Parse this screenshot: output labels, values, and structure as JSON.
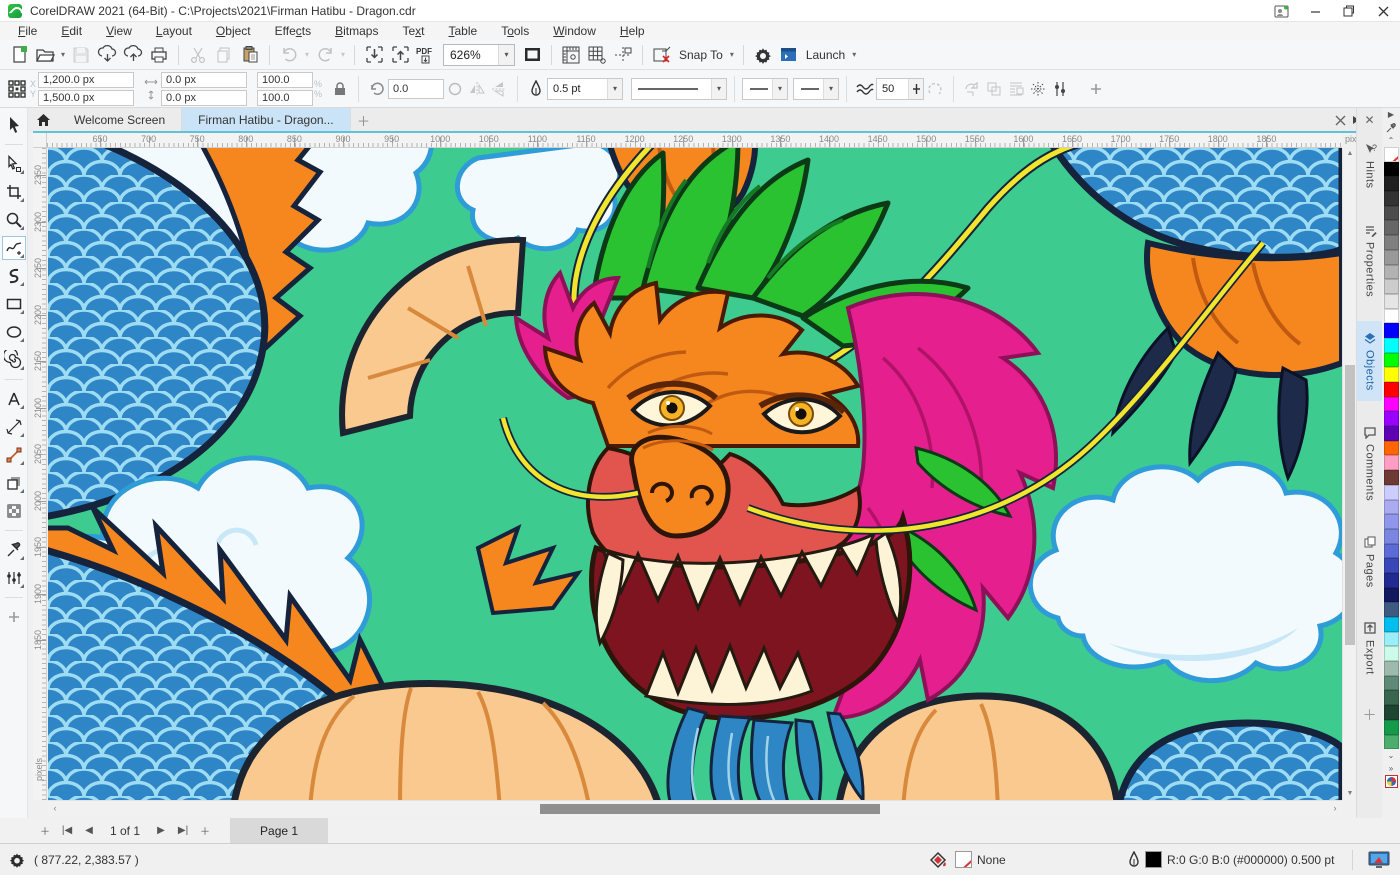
{
  "window": {
    "title": "CorelDRAW 2021 (64-Bit) - C:\\Projects\\2021\\Firman Hatibu - Dragon.cdr"
  },
  "menu": {
    "items": [
      {
        "label": "File",
        "u": 0
      },
      {
        "label": "Edit",
        "u": 0
      },
      {
        "label": "View",
        "u": 0
      },
      {
        "label": "Layout",
        "u": 0
      },
      {
        "label": "Object",
        "u": 0
      },
      {
        "label": "Effects",
        "u": 4
      },
      {
        "label": "Bitmaps",
        "u": 0
      },
      {
        "label": "Text",
        "u": 2
      },
      {
        "label": "Table",
        "u": 0
      },
      {
        "label": "Tools",
        "u": 1
      },
      {
        "label": "Window",
        "u": 0
      },
      {
        "label": "Help",
        "u": 0
      }
    ]
  },
  "toolbar": {
    "zoom_value": "626%",
    "snap_to_label": "Snap To",
    "launch_label": "Launch"
  },
  "property_bar": {
    "pos_x": "1,200.0 px",
    "pos_y": "1,500.0 px",
    "size_w": "0.0 px",
    "size_h": "0.0 px",
    "scale_x": "100.0",
    "scale_y": "100.0",
    "angle": "0.0",
    "outline_width": "0.5 pt",
    "smooth_value": "50"
  },
  "doc_tabs": {
    "welcome": "Welcome Screen",
    "active_doc": "Firman Hatibu - Dragon..."
  },
  "rulers": {
    "unit": "pixels",
    "h_labels": [
      "650",
      "700",
      "750",
      "800",
      "850",
      "900",
      "950",
      "1000",
      "1050",
      "1100",
      "1150",
      "1200",
      "1250",
      "1300",
      "1350",
      "1400",
      "1450",
      "1500",
      "1550",
      "1600",
      "1650",
      "1700",
      "1750",
      "1800",
      "1850"
    ],
    "h_start": 53,
    "h_step": 48.6,
    "v_labels": [
      "2350",
      "2300",
      "2250",
      "2200",
      "2150",
      "2100",
      "2050",
      "2000",
      "1950",
      "1900",
      "1850"
    ],
    "v_start": 27,
    "v_step": 46.5
  },
  "toolbox": {
    "tools": [
      {
        "name": "pick-tool",
        "icon": "pick",
        "sep_after": true
      },
      {
        "name": "shape-tool",
        "icon": "shape",
        "flyout": true
      },
      {
        "name": "crop-tool",
        "icon": "crop",
        "flyout": true
      },
      {
        "name": "zoom-tool",
        "icon": "zoom",
        "flyout": true
      },
      {
        "name": "freehand-tool",
        "icon": "freehand",
        "flyout": true,
        "selected": true
      },
      {
        "name": "artistic-media-tool",
        "icon": "artistic",
        "flyout": true
      },
      {
        "name": "rectangle-tool",
        "icon": "rect",
        "flyout": true
      },
      {
        "name": "ellipse-tool",
        "icon": "ellipse",
        "flyout": true
      },
      {
        "name": "polygon-tool",
        "icon": "spiral",
        "flyout": true,
        "sep_after": true
      },
      {
        "name": "text-tool",
        "icon": "text",
        "flyout": true
      },
      {
        "name": "dimension-tool",
        "icon": "dimension",
        "flyout": true
      },
      {
        "name": "connector-tool",
        "icon": "connector",
        "flyout": true
      },
      {
        "name": "drop-shadow-tool",
        "icon": "shadow",
        "flyout": true
      },
      {
        "name": "transparency-tool",
        "icon": "transparency",
        "sep_after": true
      },
      {
        "name": "eyedropper-tool",
        "icon": "eyedropper",
        "flyout": true
      },
      {
        "name": "interactive-fill-tool",
        "icon": "fill",
        "flyout": true,
        "sep_after": true
      },
      {
        "name": "more-tools",
        "icon": "plus"
      }
    ]
  },
  "dockers": {
    "tabs": [
      {
        "label": "Hints",
        "icon": "hints",
        "active": false
      },
      {
        "label": "Properties",
        "icon": "properties",
        "active": false
      },
      {
        "label": "Objects",
        "icon": "objects",
        "active": true
      },
      {
        "label": "Comments",
        "icon": "comments",
        "active": false
      },
      {
        "label": "Pages",
        "icon": "pages",
        "active": false
      },
      {
        "label": "Export",
        "icon": "export",
        "active": false
      }
    ]
  },
  "palette": {
    "colors": [
      "none",
      "#000000",
      "#1f1f1f",
      "#333333",
      "#4c4c4c",
      "#666666",
      "#7f7f7f",
      "#999999",
      "#b2b2b2",
      "#cccccc",
      "#e5e5e5",
      "#ffffff",
      "#0000ff",
      "#00ffff",
      "#00ff00",
      "#ffff00",
      "#ff0000",
      "#ff00ff",
      "#9900ff",
      "#5e00b3",
      "#ff6600",
      "#ff9ec2",
      "#6e3a34",
      "#ccccff",
      "#ababf2",
      "#9096ea",
      "#7b86e0",
      "#5c6bd6",
      "#3947b8",
      "#202a90",
      "#12195f",
      "#3d5a80",
      "#00bfef",
      "#99eef7",
      "#ccfbe9",
      "#9dbbad",
      "#5e8a77",
      "#39664f",
      "#1c4632",
      "#159a4a",
      "#4cae6d"
    ]
  },
  "page_bar": {
    "counter": "1 of 1",
    "page_tab": "Page 1"
  },
  "status_bar": {
    "coords": "( 877.22, 2,383.57 )",
    "fill_value": "None",
    "outline_value": "R:0 G:0 B:0 (#000000)  0.500 pt"
  },
  "canvas": {
    "colors": {
      "background": "#3ecb90",
      "body_blue": "#2e86c6",
      "scale_line": "#9edcf4",
      "outline_navy": "#16233c",
      "belly_peach": "#f9c98f",
      "belly_line": "#d8893c",
      "flame_orange": "#f6871f",
      "mane_magenta": "#e61f8f",
      "horn_green": "#2ac230",
      "whisker_yellow": "#f2e52e",
      "cloud_fill": "#f2fafe",
      "cloud_outline": "#2f9cd8"
    }
  }
}
